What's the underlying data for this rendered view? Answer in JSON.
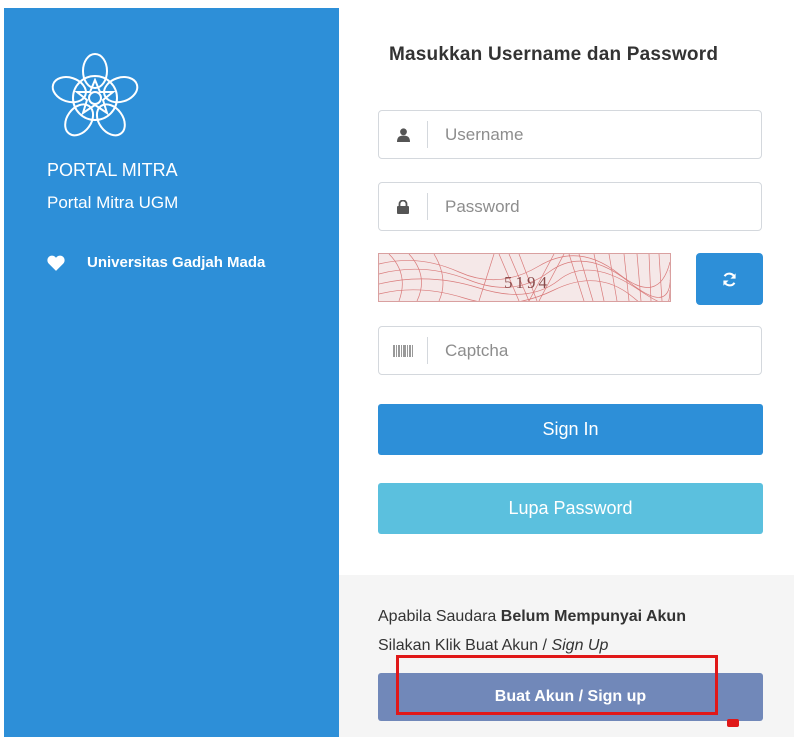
{
  "sidebar": {
    "brand_title": "PORTAL MITRA",
    "brand_subtitle": "Portal Mitra UGM",
    "university": "Universitas Gadjah Mada",
    "university_icon": "heart-icon"
  },
  "login": {
    "heading": "Masukkan Username dan Password",
    "username_placeholder": "Username",
    "username_icon": "user-icon",
    "password_placeholder": "Password",
    "password_icon": "lock-icon",
    "captcha_text": "5194",
    "refresh_icon": "refresh-icon",
    "captcha_placeholder": "Captcha",
    "captcha_icon": "barcode-icon",
    "signin_label": "Sign In",
    "forgot_label": "Lupa Password"
  },
  "footer": {
    "line1_prefix": "Apabila Saudara ",
    "line1_bold": "Belum Mempunyai Akun",
    "line2_prefix": "Silakan Klik Buat Akun / ",
    "line2_italic": "Sign Up",
    "signup_label": "Buat Akun / Sign up"
  },
  "colors": {
    "primary": "#2d8fd8",
    "info": "#5bc0de",
    "signup": "#7188b9",
    "highlight": "#e01818"
  }
}
